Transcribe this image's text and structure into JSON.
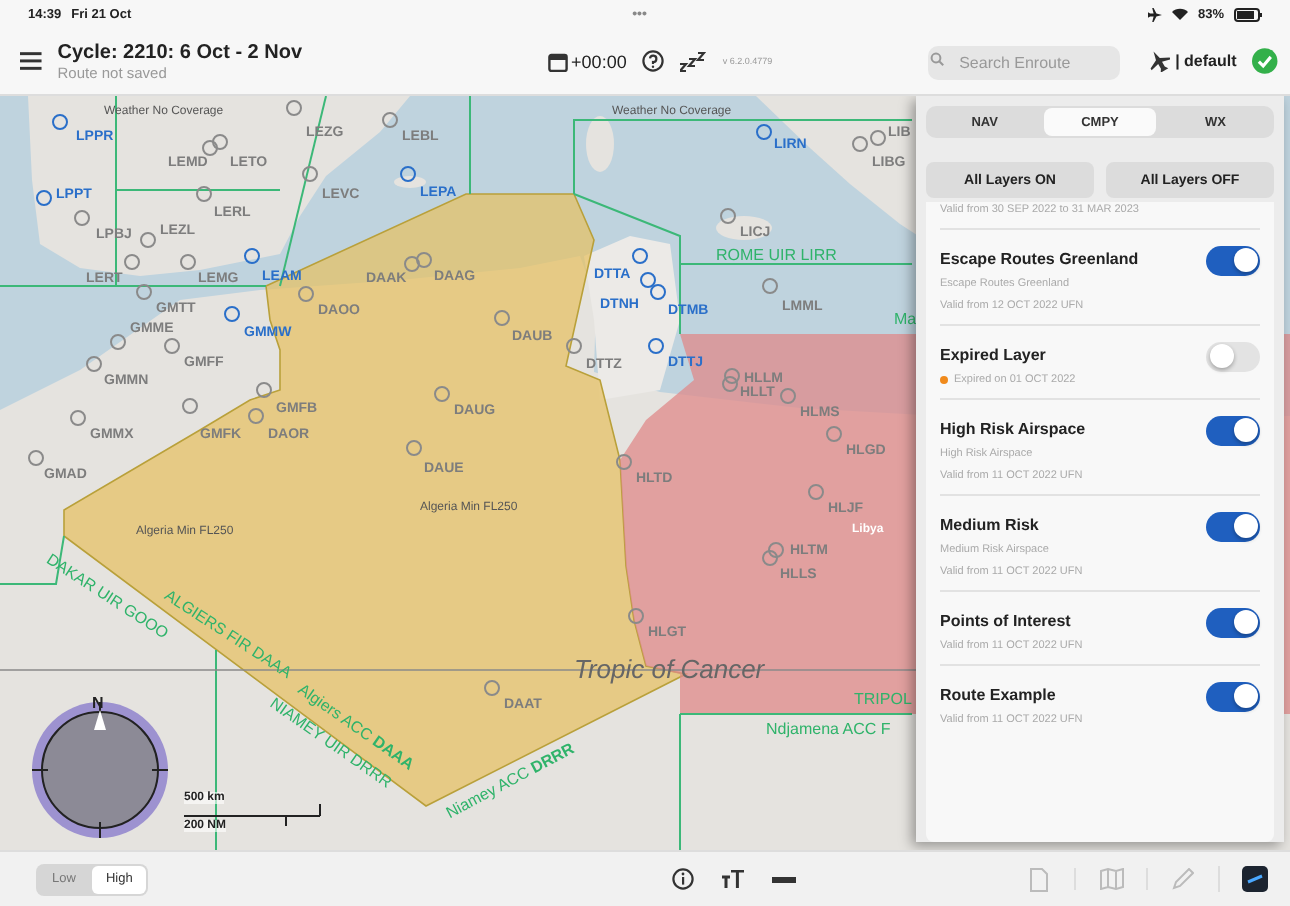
{
  "status_bar": {
    "time": "14:39",
    "date": "Fri 21 Oct",
    "dots": "•••",
    "battery": "83%"
  },
  "toolbar": {
    "cycle": "Cycle: 2210: 6 Oct - 2 Nov",
    "route_status": "Route not saved",
    "time_offset": "+00:00",
    "version": "v 6.2.0.4779",
    "search": {
      "placeholder": "Search Enroute"
    },
    "profile": "| default"
  },
  "map": {
    "airports": [
      {
        "code": "LPPR",
        "kind": "major"
      },
      {
        "code": "LEZG",
        "kind": "minor"
      },
      {
        "code": "LEBL",
        "kind": "minor"
      },
      {
        "code": "LIRN",
        "kind": "major"
      },
      {
        "code": "LIB",
        "kind": "minor"
      },
      {
        "code": "LEMD",
        "kind": "minor"
      },
      {
        "code": "LETO",
        "kind": "minor"
      },
      {
        "code": "LIBG",
        "kind": "minor"
      },
      {
        "code": "LPPT",
        "kind": "major"
      },
      {
        "code": "LEVC",
        "kind": "minor"
      },
      {
        "code": "LEPA",
        "kind": "major"
      },
      {
        "code": "LERL",
        "kind": "minor"
      },
      {
        "code": "LPBJ",
        "kind": "minor"
      },
      {
        "code": "LEZL",
        "kind": "minor"
      },
      {
        "code": "LICJ",
        "kind": "minor"
      },
      {
        "code": "LERT",
        "kind": "minor"
      },
      {
        "code": "LEMG",
        "kind": "minor"
      },
      {
        "code": "LEAM",
        "kind": "major"
      },
      {
        "code": "DAAK",
        "kind": "minor"
      },
      {
        "code": "DAAG",
        "kind": "minor"
      },
      {
        "code": "DTTA",
        "kind": "major"
      },
      {
        "code": "GMTT",
        "kind": "minor"
      },
      {
        "code": "DAOO",
        "kind": "minor"
      },
      {
        "code": "DTNH",
        "kind": "major"
      },
      {
        "code": "DTMB",
        "kind": "major"
      },
      {
        "code": "LMML",
        "kind": "minor"
      },
      {
        "code": "GMME",
        "kind": "minor"
      },
      {
        "code": "GMMW",
        "kind": "major"
      },
      {
        "code": "DAUB",
        "kind": "minor"
      },
      {
        "code": "GMFF",
        "kind": "minor"
      },
      {
        "code": "DTTZ",
        "kind": "minor"
      },
      {
        "code": "DTTJ",
        "kind": "major"
      },
      {
        "code": "GMMN",
        "kind": "minor"
      },
      {
        "code": "HLLM",
        "kind": "minor"
      },
      {
        "code": "HLLT",
        "kind": "minor"
      },
      {
        "code": "GMFB",
        "kind": "minor"
      },
      {
        "code": "DAUG",
        "kind": "minor"
      },
      {
        "code": "HLMS",
        "kind": "minor"
      },
      {
        "code": "GMMX",
        "kind": "minor"
      },
      {
        "code": "GMFK",
        "kind": "minor"
      },
      {
        "code": "DAOR",
        "kind": "minor"
      },
      {
        "code": "HLGD",
        "kind": "minor"
      },
      {
        "code": "GMAD",
        "kind": "minor"
      },
      {
        "code": "DAUE",
        "kind": "minor"
      },
      {
        "code": "HLTD",
        "kind": "minor"
      },
      {
        "code": "HLJF",
        "kind": "minor"
      },
      {
        "code": "HLTM",
        "kind": "minor"
      },
      {
        "code": "HLLS",
        "kind": "minor"
      },
      {
        "code": "HLGT",
        "kind": "minor"
      },
      {
        "code": "DAAT",
        "kind": "minor"
      }
    ],
    "labels": [
      {
        "text": "Weather No Coverage",
        "kind": "note"
      },
      {
        "text": "Weather No Coverage",
        "kind": "note"
      },
      {
        "text": "ROME UIR LIRR",
        "kind": "boundary"
      },
      {
        "text": "Ma",
        "kind": "boundary"
      },
      {
        "text": "Libya",
        "kind": "country"
      },
      {
        "text": "Algeria Min FL250",
        "kind": "note"
      },
      {
        "text": "Algeria Min FL250",
        "kind": "note"
      },
      {
        "text": "DAKAR UIR GOOO",
        "kind": "boundary"
      },
      {
        "text": "ALGIERS FIR DAAA",
        "kind": "boundary"
      },
      {
        "text": "Tropic of Cancer",
        "kind": "parallel"
      },
      {
        "text": "NIAMEY UIR DRRR",
        "kind": "boundary"
      },
      {
        "text": "Algiers ACC **DAAA**",
        "kind": "boundary"
      },
      {
        "text": "TRIPOL",
        "kind": "boundary"
      },
      {
        "text": "Ndjamena ACC F",
        "kind": "boundary"
      },
      {
        "text": "Niamey ACC **DRRR**",
        "kind": "boundary"
      }
    ],
    "compass": {
      "north": "N"
    },
    "scale": {
      "metric": "500 km",
      "nautical": "200 NM"
    }
  },
  "altitude": [
    {
      "label": "Low",
      "selected": false
    },
    {
      "label": "High",
      "selected": true
    }
  ],
  "layers_panel": {
    "tabs": [
      {
        "label": "NAV",
        "selected": false
      },
      {
        "label": "CMPY",
        "selected": true
      },
      {
        "label": "WX",
        "selected": false
      }
    ],
    "buttons": [
      "All Layers ON",
      "All Layers OFF"
    ],
    "partial_validity": "Valid from 30 SEP 2022 to 31 MAR 2023",
    "layers": [
      {
        "name": "Escape Routes Greenland",
        "kind": "active",
        "description": "Escape Routes Greenland",
        "validity": "Valid from 12 OCT 2022 UFN",
        "on": true
      },
      {
        "name": "Expired Layer",
        "kind": "expired",
        "validity": "Expired on 01 OCT 2022",
        "on": false
      },
      {
        "name": "High Risk Airspace",
        "kind": "active",
        "description": "High Risk Airspace",
        "validity": "Valid from 11 OCT 2022 UFN",
        "on": true
      },
      {
        "name": "Medium Risk",
        "kind": "active",
        "description": "Medium Risk Airspace",
        "validity": "Valid from 11 OCT 2022 UFN",
        "on": true
      },
      {
        "name": "Points of Interest",
        "kind": "active",
        "validity": "Valid from 11 OCT 2022 UFN",
        "on": true
      },
      {
        "name": "Route Example",
        "kind": "active",
        "validity": "Valid from 11 OCT 2022 UFN",
        "on": true
      }
    ]
  }
}
